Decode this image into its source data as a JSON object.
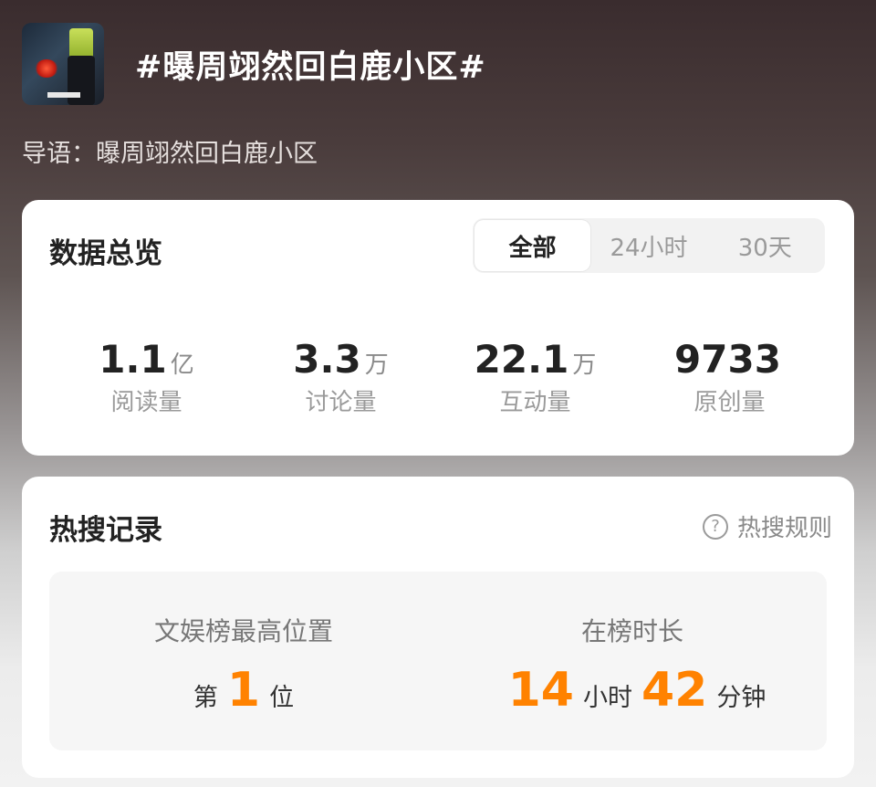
{
  "topic": {
    "title": "#曝周翊然回白鹿小区#",
    "intro": "导语：曝周翊然回白鹿小区"
  },
  "overview": {
    "title": "数据总览",
    "tabs": [
      {
        "label": "全部",
        "active": true
      },
      {
        "label": "24小时",
        "active": false
      },
      {
        "label": "30天",
        "active": false
      }
    ],
    "stats": [
      {
        "value": "1.1",
        "unit": "亿",
        "label": "阅读量"
      },
      {
        "value": "3.3",
        "unit": "万",
        "label": "讨论量"
      },
      {
        "value": "22.1",
        "unit": "万",
        "label": "互动量"
      },
      {
        "value": "9733",
        "unit": "",
        "label": "原创量"
      }
    ]
  },
  "hot_search": {
    "title": "热搜记录",
    "rules_label": "热搜规则",
    "rules_icon": "question-circle-icon",
    "peak": {
      "label": "文娱榜最高位置",
      "prefix": "第",
      "rank": "1",
      "suffix": "位"
    },
    "duration": {
      "label": "在榜时长",
      "hours": "14",
      "hours_unit": "小时",
      "minutes": "42",
      "minutes_unit": "分钟"
    },
    "accent_color": "#ff8200"
  }
}
